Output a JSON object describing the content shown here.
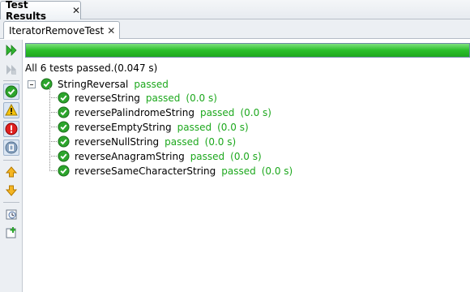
{
  "window_tab": {
    "title": "Test Results",
    "close": "✕"
  },
  "sub_tab": {
    "title": "IteratorRemoveTest",
    "close": "✕"
  },
  "progress": {
    "fraction": 1.0,
    "color": "#2bbf2b"
  },
  "summary": "All 6 tests passed.(0.047 s)",
  "suite": {
    "name": "StringReversal",
    "status": "passed"
  },
  "tests": [
    {
      "name": "reverseString",
      "status": "passed",
      "time": "(0.0 s)"
    },
    {
      "name": "reversePalindromeString",
      "status": "passed",
      "time": "(0.0 s)"
    },
    {
      "name": "reverseEmptyString",
      "status": "passed",
      "time": "(0.0 s)"
    },
    {
      "name": "reverseNullString",
      "status": "passed",
      "time": "(0.0 s)"
    },
    {
      "name": "reverseAnagramString",
      "status": "passed",
      "time": "(0.0 s)"
    },
    {
      "name": "reverseSameCharacterString",
      "status": "passed",
      "time": "(0.0 s)"
    }
  ],
  "toolbar": {
    "icons": [
      "rerun-icon",
      "rerun-failed-icon",
      "show-passed-icon",
      "show-warnings-icon",
      "show-errors-icon",
      "show-ignored-icon",
      "previous-failure-icon",
      "next-failure-icon",
      "history-icon",
      "new-test-icon"
    ]
  },
  "colors": {
    "passed": "#1da81d",
    "accent": "#2bbf2b"
  }
}
